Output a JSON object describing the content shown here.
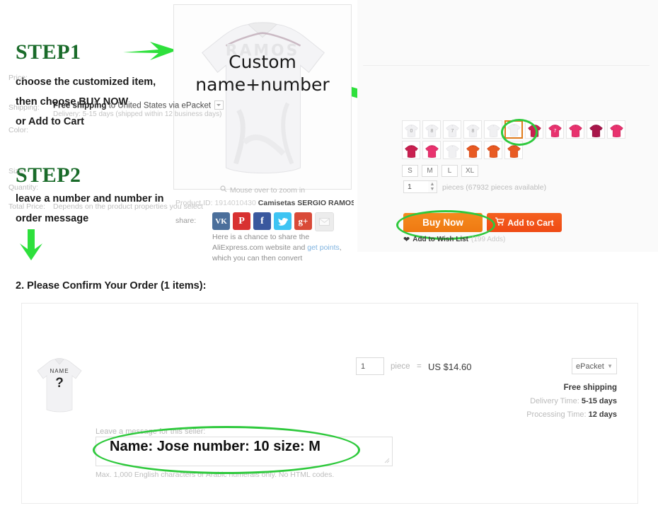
{
  "instructions": {
    "step1": {
      "title": "STEP1",
      "lines": [
        "choose the customized item,",
        "then choose BUY NOW",
        "or Add to Cart"
      ]
    },
    "step2": {
      "title": "STEP2",
      "lines": [
        "leave a number and number in",
        "order message"
      ]
    },
    "annotation_color": "#2ee03c",
    "title_color": "#1a6b2a"
  },
  "gallery": {
    "overlay_line1": "Custom",
    "overlay_line2": "name+number",
    "zoom_hint": "Mouse over to zoom in",
    "zoom_icon": "magnifier-icon",
    "product_id_label": "Product ID:",
    "product_id_value": "1914010430",
    "product_title": "Camisetas SERGIO RAMOS Soccer ...",
    "share_label": "share:",
    "share_buttons": [
      {
        "name": "vk",
        "glyph": "VK"
      },
      {
        "name": "pinterest",
        "glyph": "P"
      },
      {
        "name": "facebook",
        "glyph": "f"
      },
      {
        "name": "twitter",
        "glyph": "t"
      },
      {
        "name": "google-plus",
        "glyph": "g+"
      },
      {
        "name": "email",
        "glyph": ""
      }
    ],
    "share_note_before": "Here is a chance to share the AliExpress.com website and ",
    "share_note_link": "get points",
    "share_note_after": ", which you can then convert"
  },
  "product_props": {
    "price_label": "Price:",
    "shipping_label": "Shipping:",
    "shipping_free": "Free shipping",
    "shipping_rest": " to United States via ePacket",
    "shipping_delivery": "Delivery: 5-15 days (shipped within 12 business days)",
    "color_label": "Color:",
    "color_row1": [
      {
        "tone": "white",
        "print": "0",
        "selected": false
      },
      {
        "tone": "white",
        "print": "8",
        "selected": false
      },
      {
        "tone": "white",
        "print": "7",
        "selected": false
      },
      {
        "tone": "white",
        "print": "8",
        "selected": false
      },
      {
        "tone": "white",
        "print": "",
        "selected": false
      },
      {
        "tone": "white",
        "print": "",
        "selected": true
      },
      {
        "tone": "crimson",
        "print": "",
        "selected": false
      },
      {
        "tone": "pink",
        "print": "7",
        "selected": false
      },
      {
        "tone": "pink",
        "print": "",
        "selected": false
      },
      {
        "tone": "darkpink",
        "print": "",
        "selected": false
      },
      {
        "tone": "pink",
        "print": "",
        "selected": false
      }
    ],
    "color_row2": [
      {
        "tone": "crimson",
        "print": "",
        "selected": false
      },
      {
        "tone": "pink",
        "print": "",
        "selected": false
      },
      {
        "tone": "white",
        "print": "",
        "selected": false
      },
      {
        "tone": "orange",
        "print": "",
        "selected": false
      },
      {
        "tone": "orange",
        "print": "",
        "selected": false
      },
      {
        "tone": "orange",
        "print": "",
        "selected": false
      }
    ],
    "size_label": "Size:",
    "sizes": [
      "S",
      "M",
      "L",
      "XL"
    ],
    "quantity_label": "Quantity:",
    "quantity_value": "1",
    "quantity_note": "pieces (67932 pieces available)",
    "total_price_label": "Total Price:",
    "total_price_note": "Depends on the product properties you select",
    "buy_now_label": "Buy Now",
    "add_to_cart_label": "Add to Cart",
    "cart_icon": "cart-icon",
    "wishlist_icon": "heart-icon",
    "wishlist_label": "Add to Wish List",
    "wishlist_count": "(199 Adds)",
    "buy_now_color": "#f2800f",
    "add_cart_color": "#ef4a14",
    "selected_swatch_border": "#e07b1b"
  },
  "order_section": {
    "heading": "2. Please Confirm Your Order (1 items):",
    "thumb_name_text": "NAME",
    "thumb_number_text": "?",
    "quantity_value": "1",
    "piece_label": "piece",
    "equals": "=",
    "unit_price": "US $14.60",
    "shipping_method": "ePacket",
    "shipping_caret": "chevron-down-icon",
    "free_shipping": "Free shipping",
    "delivery_label": "Delivery Time:",
    "delivery_value": "5-15 days",
    "processing_label": "Processing Time:",
    "processing_value": "12 days",
    "message_label": "Leave a message for this seller:",
    "message_value": "Name: Jose number: 10 size: M",
    "message_hint": "Max. 1,000 English characters or Arabic numerals only. No HTML codes."
  }
}
